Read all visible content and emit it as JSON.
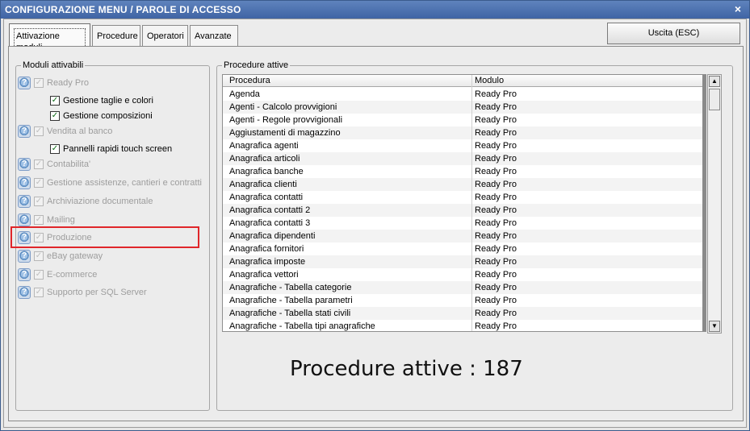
{
  "window": {
    "title": "CONFIGURAZIONE MENU / PAROLE DI ACCESSO",
    "close_glyph": "×"
  },
  "tabs": [
    {
      "label": "Attivazione moduli"
    },
    {
      "label": "Procedure"
    },
    {
      "label": "Operatori"
    },
    {
      "label": "Avanzate"
    }
  ],
  "exit_button": "Uscita (ESC)",
  "modules": {
    "legend": "Moduli attivabili",
    "items": [
      {
        "label": "Ready Pro",
        "enabled": false,
        "info": true
      },
      {
        "label": "Gestione taglie e colori",
        "enabled": true,
        "info": false
      },
      {
        "label": "Gestione composizioni",
        "enabled": true,
        "info": false
      },
      {
        "label": "Vendita al banco",
        "enabled": false,
        "info": true
      },
      {
        "label": "Pannelli rapidi touch screen",
        "enabled": true,
        "info": false
      },
      {
        "label": "Contabilita'",
        "enabled": false,
        "info": true
      },
      {
        "label": "Gestione assistenze, cantieri e contratti",
        "enabled": false,
        "info": true
      },
      {
        "label": "Archiviazione documentale",
        "enabled": false,
        "info": true
      },
      {
        "label": "Mailing",
        "enabled": false,
        "info": true
      },
      {
        "label": "Produzione",
        "enabled": false,
        "info": true
      },
      {
        "label": "eBay gateway",
        "enabled": false,
        "info": true
      },
      {
        "label": "E-commerce",
        "enabled": false,
        "info": true
      },
      {
        "label": "Supporto per SQL Server",
        "enabled": false,
        "info": true
      }
    ]
  },
  "procedures": {
    "legend": "Procedure attive",
    "columns": [
      "Procedura",
      "Modulo"
    ],
    "rows": [
      [
        "Agenda",
        "Ready Pro"
      ],
      [
        "Agenti - Calcolo provvigioni",
        "Ready Pro"
      ],
      [
        "Agenti - Regole provvigionali",
        "Ready Pro"
      ],
      [
        "Aggiustamenti di magazzino",
        "Ready Pro"
      ],
      [
        "Anagrafica agenti",
        "Ready Pro"
      ],
      [
        "Anagrafica articoli",
        "Ready Pro"
      ],
      [
        "Anagrafica banche",
        "Ready Pro"
      ],
      [
        "Anagrafica clienti",
        "Ready Pro"
      ],
      [
        "Anagrafica contatti",
        "Ready Pro"
      ],
      [
        "Anagrafica contatti 2",
        "Ready Pro"
      ],
      [
        "Anagrafica contatti 3",
        "Ready Pro"
      ],
      [
        "Anagrafica dipendenti",
        "Ready Pro"
      ],
      [
        "Anagrafica fornitori",
        "Ready Pro"
      ],
      [
        "Anagrafica imposte",
        "Ready Pro"
      ],
      [
        "Anagrafica vettori",
        "Ready Pro"
      ],
      [
        "Anagrafiche - Tabella categorie",
        "Ready Pro"
      ],
      [
        "Anagrafiche - Tabella parametri",
        "Ready Pro"
      ],
      [
        "Anagrafiche - Tabella stati civili",
        "Ready Pro"
      ],
      [
        "Anagrafiche - Tabella tipi anagrafiche",
        "Ready Pro"
      ]
    ],
    "count_text": "Procedure attive : 187"
  }
}
